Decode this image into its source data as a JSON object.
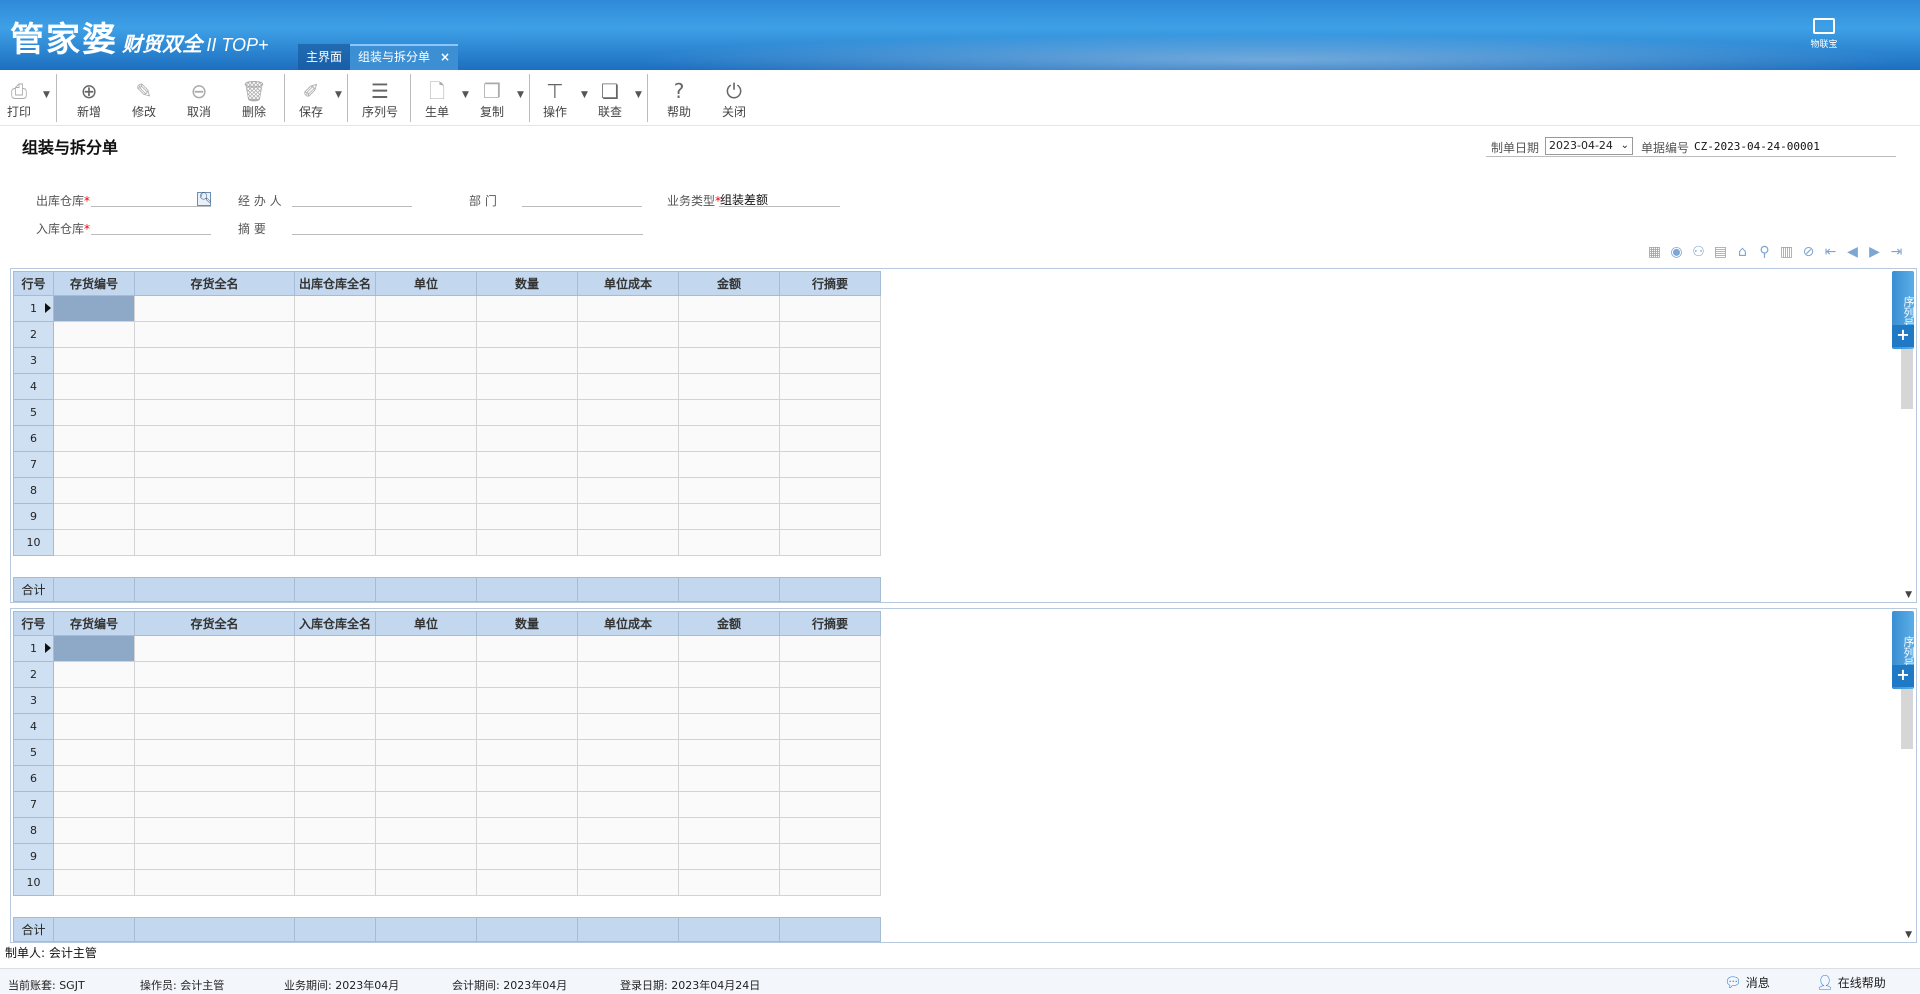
{
  "header": {
    "logo_main": "管家婆",
    "logo_sub": "财贸双全",
    "logo_ver": "II TOP+",
    "tabs": [
      {
        "label": "主界面"
      },
      {
        "label": "组装与拆分单",
        "close": "×"
      }
    ],
    "wuliao_label": "物联宝"
  },
  "toolbar": {
    "print": "打印",
    "add": "新增",
    "edit": "修改",
    "cancel": "取消",
    "delete": "删除",
    "save": "保存",
    "serial": "序列号",
    "gen": "生单",
    "copy": "复制",
    "operate": "操作",
    "link": "联查",
    "help": "帮助",
    "close": "关闭"
  },
  "form": {
    "title": "组装与拆分单",
    "date_label": "制单日期",
    "date_value": "2023-04-24",
    "billno_label": "单据编号",
    "billno_value": "CZ-2023-04-24-00001",
    "out_wh_label": "出库仓库",
    "in_wh_label": "入库仓库",
    "handler_label": "经 办 人",
    "summary_label": "摘    要",
    "dept_label": "部    门",
    "biztype_label": "业务类型",
    "biztype_value": "组装差额",
    "lookup_icon": "search-icon"
  },
  "grid_top": {
    "headers": [
      "行号",
      "存货编号",
      "存货全名",
      "出库仓库全名",
      "单位",
      "数量",
      "单位成本",
      "金额",
      "行摘要"
    ],
    "rows": [
      "1",
      "2",
      "3",
      "4",
      "5",
      "6",
      "7",
      "8",
      "9",
      "10"
    ],
    "sum_label": "合计",
    "side_tab": "序列号",
    "side_plus": "+"
  },
  "grid_bottom": {
    "headers": [
      "行号",
      "存货编号",
      "存货全名",
      "入库仓库全名",
      "单位",
      "数量",
      "单位成本",
      "金额",
      "行摘要"
    ],
    "rows": [
      "1",
      "2",
      "3",
      "4",
      "5",
      "6",
      "7",
      "8",
      "9",
      "10"
    ],
    "sum_label": "合计",
    "side_tab": "序列号",
    "side_plus": "+"
  },
  "footer": {
    "maker": "制单人: 会计主管",
    "account": "当前账套: SGJT",
    "operator": "操作员: 会计主管",
    "biz_period": "业务期间: 2023年04月",
    "acc_period": "会计期间: 2023年04月",
    "login_date": "登录日期: 2023年04月24日",
    "message": "消息",
    "online_help": "在线帮助"
  }
}
